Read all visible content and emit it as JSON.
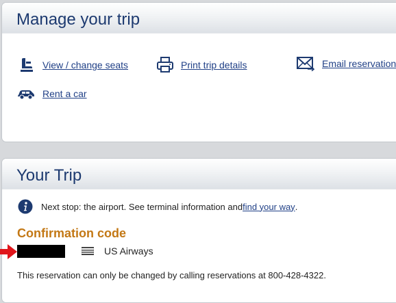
{
  "manage": {
    "title": "Manage your trip",
    "actions": {
      "seats": {
        "label": "View / change seats",
        "icon": "seat-icon"
      },
      "print": {
        "label": "Print trip details",
        "icon": "printer-icon"
      },
      "email": {
        "label": "Email reservation",
        "icon": "envelope-icon"
      },
      "car": {
        "label": "Rent a car",
        "icon": "car-icon"
      }
    }
  },
  "trip": {
    "title": "Your Trip",
    "info_text": "Next stop: the airport. See terminal information and ",
    "info_link": "find your way",
    "info_end": ".",
    "confirmation_label": "Confirmation code",
    "airline": "US Airways",
    "note": "This reservation can only be changed by calling reservations at 800-428-4322."
  },
  "colors": {
    "title": "#1d3a70",
    "link": "#1f3f86",
    "accent": "#c37815",
    "arrow": "#e0161b"
  }
}
